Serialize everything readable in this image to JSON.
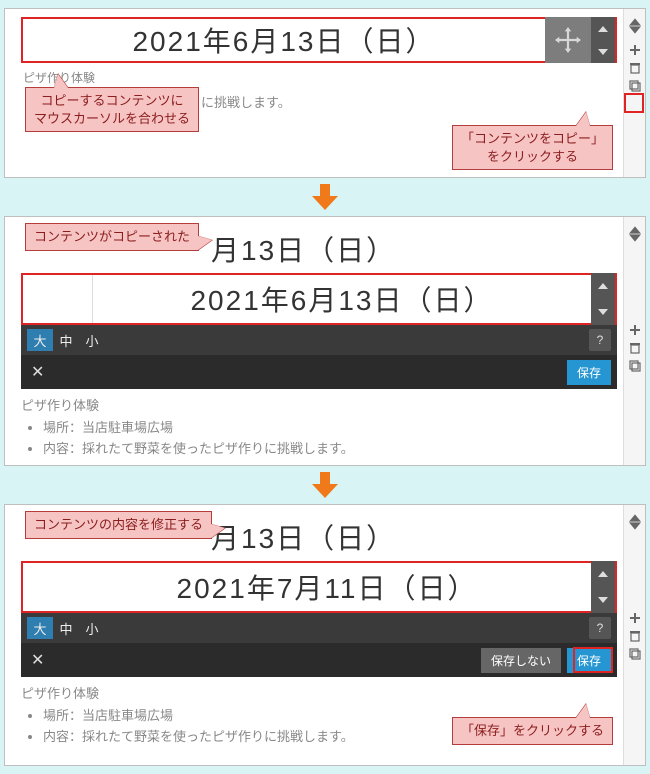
{
  "stage1": {
    "title": "2021年6月13日（日）",
    "sub_label": "ピザ作り体験",
    "desc_tail": "に挑戦します。",
    "callout_hover": "コピーするコンテンツに\nマウスカーソルを合わせる",
    "callout_copy": "「コンテンツをコピー」\nをクリックする"
  },
  "stage2": {
    "callout_copied": "コンテンツがコピーされた",
    "existing_title": "月13日（日）",
    "editor_title": "2021年6月13日（日）",
    "size_large": "大",
    "size_medium": "中",
    "size_small": "小",
    "help": "?",
    "close": "✕",
    "save": "保存",
    "desc_heading": "ピザ作り体験",
    "desc_items": [
      "場所：当店駐車場広場",
      "内容：採れたて野菜を使ったピザ作りに挑戦します。"
    ]
  },
  "stage3": {
    "callout_edit": "コンテンツの内容を修正する",
    "existing_title": "月13日（日）",
    "editor_title": "2021年7月11日（日）",
    "size_large": "大",
    "size_medium": "中",
    "size_small": "小",
    "help": "?",
    "close": "✕",
    "btn_nosave": "保存しない",
    "btn_save": "保存",
    "callout_save": "「保存」をクリックする",
    "desc_heading": "ピザ作り体験",
    "desc_items": [
      "場所：当店駐車場広場",
      "内容：採れたて野菜を使ったピザ作りに挑戦します。"
    ]
  }
}
